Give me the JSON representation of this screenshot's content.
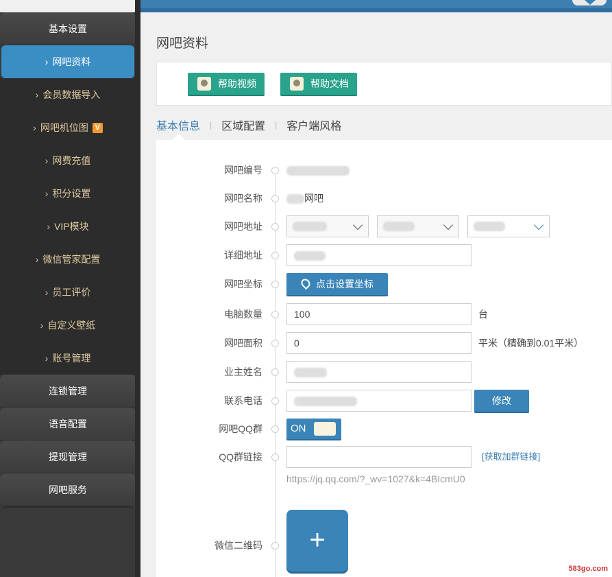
{
  "sidebar": {
    "items": [
      {
        "label": "基本设置",
        "kind": "group"
      },
      {
        "label": "网吧资料",
        "kind": "sub",
        "active": true
      },
      {
        "label": "会员数据导入",
        "kind": "sub"
      },
      {
        "label": "网吧机位图",
        "kind": "sub",
        "badge": "V"
      },
      {
        "label": "网费充值",
        "kind": "sub"
      },
      {
        "label": "积分设置",
        "kind": "sub"
      },
      {
        "label": "VIP模块",
        "kind": "sub"
      },
      {
        "label": "微信管家配置",
        "kind": "sub"
      },
      {
        "label": "员工评价",
        "kind": "sub"
      },
      {
        "label": "自定义壁纸",
        "kind": "sub"
      },
      {
        "label": "账号管理",
        "kind": "sub"
      },
      {
        "label": "连锁管理",
        "kind": "group"
      },
      {
        "label": "语音配置",
        "kind": "group"
      },
      {
        "label": "提现管理",
        "kind": "group"
      },
      {
        "label": "网吧服务",
        "kind": "group"
      }
    ]
  },
  "main": {
    "title": "网吧资料",
    "help_video_label": "帮助视频",
    "help_doc_label": "帮助文档",
    "tabs": [
      {
        "label": "基本信息",
        "active": true
      },
      {
        "label": "区域配置"
      },
      {
        "label": "客户端风格"
      }
    ]
  },
  "form": {
    "cafe_id_label": "网吧编号",
    "cafe_name_label": "网吧名称",
    "cafe_name_suffix": "网吧",
    "address_label": "网吧地址",
    "detail_address_label": "详细地址",
    "coord_label": "网吧坐标",
    "coord_button": "点击设置坐标",
    "pc_count_label": "电脑数量",
    "pc_count_value": "100",
    "pc_count_unit": "台",
    "area_label": "网吧面积",
    "area_value": "0",
    "area_unit": "平米（精确到0.01平米）",
    "owner_label": "业主姓名",
    "phone_label": "联系电话",
    "modify_button": "修改",
    "qq_group_label": "网吧QQ群",
    "qq_group_toggle": "ON",
    "qq_link_label": "QQ群链接",
    "qq_link_action": "[获取加群链接]",
    "qq_link_hint": "https://jq.qq.com/?_wv=1027&k=4BIcmU0",
    "wechat_qr_label": "微信二维码",
    "upload_symbol": "+"
  },
  "watermark": "583go.com",
  "colors": {
    "accent": "#3b84b8",
    "teal_button": "#2aa38c",
    "badge": "#f29a2e",
    "sidebar_bg": "#2c2c2c"
  }
}
